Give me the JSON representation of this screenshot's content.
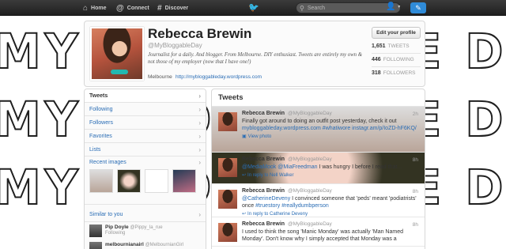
{
  "background": {
    "lettering": "MY BLOGGABLE DAY"
  },
  "topbar": {
    "home": "Home",
    "connect": "Connect",
    "discover": "Discover",
    "search_placeholder": "Search",
    "icons": {
      "home": "home-icon",
      "connect": "at-icon",
      "discover": "hash-icon",
      "bird": "bird-icon",
      "search": "search-icon",
      "user": "user-icon",
      "compose": "compose-icon"
    }
  },
  "profile": {
    "name": "Rebecca Brewin",
    "handle": "@MyBloggableDay",
    "bio": "Journalist for a daily. And blogger. From Melbourne. DIY enthusiast. Tweets are entirely my own & not those of my employer (now that I have one!)",
    "location": "Melbourne",
    "url": "http://mybloggableday.wordpress.com",
    "edit_label": "Edit your profile",
    "stats": {
      "tweets": {
        "value": "1,651",
        "label": "TWEETS"
      },
      "following": {
        "value": "446",
        "label": "FOLLOWING"
      },
      "followers": {
        "value": "318",
        "label": "FOLLOWERS"
      }
    }
  },
  "leftnav": {
    "items": [
      "Tweets",
      "Following",
      "Followers",
      "Favorites",
      "Lists"
    ],
    "recent_images": "Recent images",
    "similar": "Similar to you",
    "similar_users": [
      {
        "name": "Pip Doyle",
        "handle": "@Pippy_la_rue",
        "status": "Following"
      },
      {
        "name": "melbournianairl",
        "handle": "@MelbournianGirl",
        "status": ""
      }
    ]
  },
  "tweets": {
    "heading": "Tweets",
    "items": [
      {
        "name": "Rebecca Brewin",
        "handle": "@MyBloggableDay",
        "time": "2h",
        "text_plain": "Finally got around to doing an outfit post yesterday, check it out",
        "text_link": "mybloggableday.wordpress.com #whatiwore instagr.am/p/IoZD-hF6KQ/",
        "meta": "View photo"
      },
      {
        "name": "Rebecca Brewin",
        "handle": "@MyBloggableDay",
        "time": "8h",
        "text_link": "@MediaMook @MiaFreedman",
        "text_plain": " I was hungry I before I read that...",
        "meta": "In reply to Nell Walker"
      },
      {
        "name": "Rebecca Brewin",
        "handle": "@MyBloggableDay",
        "time": "8h",
        "text_link": "@CatherineDeveny",
        "text_plain": " I convinced someone that 'peds' meant 'podiatrists' once ",
        "text_link2": "#truestory #reallydumbperson",
        "meta": "In reply to Catherine Deveny"
      },
      {
        "name": "Rebecca Brewin",
        "handle": "@MyBloggableDay",
        "time": "8h",
        "text_plain": "I used to think the song 'Manic Monday' was actually 'Man Named Monday'. Don't know why I simply accepted that Monday was a"
      }
    ]
  }
}
